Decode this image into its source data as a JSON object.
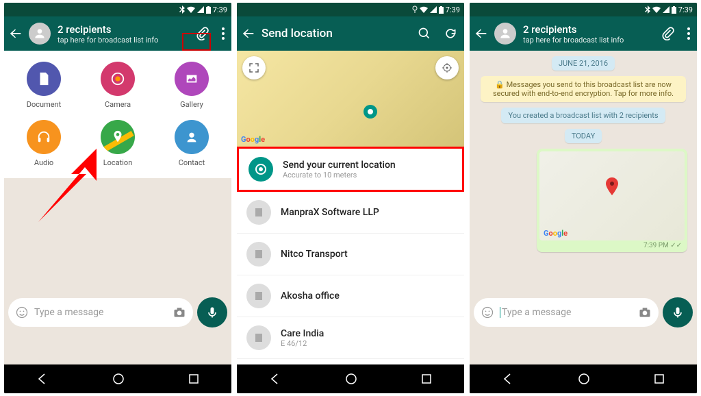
{
  "status": {
    "time": "7:39"
  },
  "screen1": {
    "title": "2 recipients",
    "subtitle": "tap here for broadcast list info",
    "attachments": [
      {
        "label": "Document",
        "color": "#5157ae"
      },
      {
        "label": "Camera",
        "color": "#d3396d"
      },
      {
        "label": "Gallery",
        "color": "#af47bb"
      },
      {
        "label": "Audio",
        "color": "#f7931e"
      },
      {
        "label": "Location",
        "color": "#37a849"
      },
      {
        "label": "Contact",
        "color": "#3d95cf"
      }
    ],
    "input_placeholder": "Type a message"
  },
  "screen2": {
    "title": "Send location",
    "map_attribution": "Google",
    "current": {
      "title": "Send your current location",
      "subtitle": "Accurate to 10 meters"
    },
    "places": [
      {
        "name": "ManpraX Software LLP",
        "sub": ""
      },
      {
        "name": "Nitco Transport",
        "sub": ""
      },
      {
        "name": "Akosha office",
        "sub": ""
      },
      {
        "name": "Care India",
        "sub": "E 46/12"
      }
    ]
  },
  "screen3": {
    "title": "2 recipients",
    "subtitle": "tap here for broadcast list info",
    "date1": "JUNE 21, 2016",
    "encryption_notice": "🔒 Messages you send to this broadcast list are now secured with end-to-end encryption. Tap for more info.",
    "system_msg": "You created a broadcast list with 2 recipients",
    "date2": "TODAY",
    "map_attribution": "Google",
    "bubble_time": "7:39 PM ✓✓",
    "input_placeholder": "Type a message"
  }
}
